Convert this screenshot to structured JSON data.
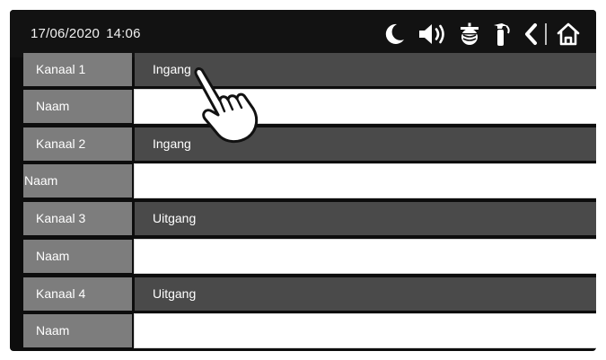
{
  "status_bar": {
    "date": "17/06/2020",
    "time": "14:06",
    "icons": [
      "moon-icon",
      "speaker-icon",
      "alarm-bell-icon",
      "fire-extinguisher-icon",
      "back-icon",
      "home-icon"
    ]
  },
  "channels": [
    {
      "channel_label": "Kanaal 1",
      "mode": "Ingang",
      "name_label": "Naam",
      "name_value": ""
    },
    {
      "channel_label": "Kanaal 2",
      "mode": "Ingang",
      "name_label": "Naam",
      "name_value": ""
    },
    {
      "channel_label": "Kanaal 3",
      "mode": "Uitgang",
      "name_label": "Naam",
      "name_value": ""
    },
    {
      "channel_label": "Kanaal 4",
      "mode": "Uitgang",
      "name_label": "Naam",
      "name_value": ""
    }
  ],
  "colors": {
    "background": "#0d0d0d",
    "label_grey": "#7d7d7d",
    "mode_field": "#4a4a4a",
    "name_field": "#ffffff"
  }
}
